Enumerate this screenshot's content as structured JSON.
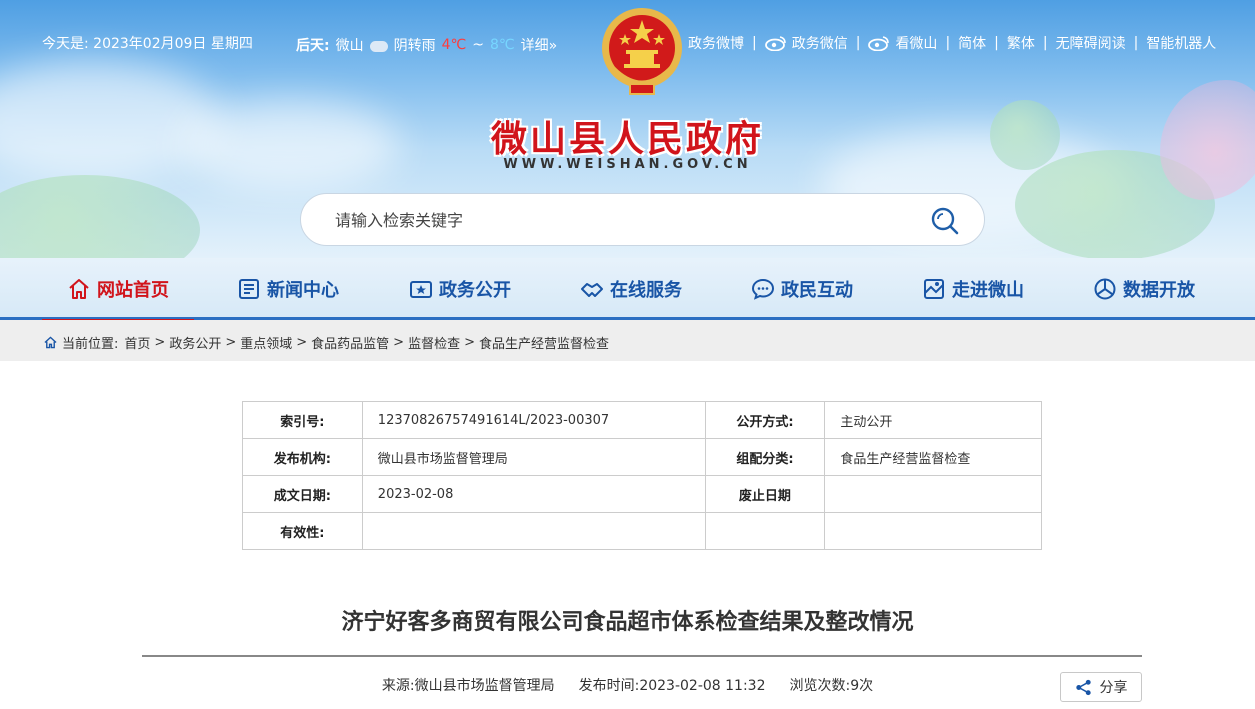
{
  "topbar": {
    "today": "今天是: 2023年02月09日 星期四",
    "weather_label": "后天:",
    "weather_city": "微山",
    "weather_desc": "阴转雨",
    "temp_high": "4℃",
    "temp_sep": "~",
    "temp_low": "8℃",
    "weather_more": "详细»",
    "links": [
      {
        "label": "政务微博",
        "icon": "weibo-icon"
      },
      {
        "label": "政务微信",
        "icon": "weibo-icon"
      },
      {
        "label": "看微山",
        "icon": "weibo-icon"
      },
      {
        "label": "简体"
      },
      {
        "label": "繁体"
      },
      {
        "label": "无障碍阅读"
      },
      {
        "label": "智能机器人"
      }
    ]
  },
  "site": {
    "title": "微山县人民政府",
    "url": "WWW.WEISHAN.GOV.CN"
  },
  "search": {
    "placeholder": "请输入检索关键字"
  },
  "nav": {
    "items": [
      {
        "label": "网站首页",
        "icon": "home-icon",
        "active": true
      },
      {
        "label": "新闻中心",
        "icon": "news-icon"
      },
      {
        "label": "政务公开",
        "icon": "gov-open-icon"
      },
      {
        "label": "在线服务",
        "icon": "handshake-icon"
      },
      {
        "label": "政民互动",
        "icon": "chat-icon"
      },
      {
        "label": "走进微山",
        "icon": "map-icon"
      },
      {
        "label": "数据开放",
        "icon": "data-icon"
      }
    ]
  },
  "breadcrumb": {
    "prefix": "当前位置:",
    "items": [
      "首页",
      "政务公开",
      "重点领域",
      "食品药品监管",
      "监督检查",
      "食品生产经营监督检查"
    ]
  },
  "meta": {
    "rows": [
      {
        "k1": "索引号:",
        "v1": "12370826757491614L/2023-00307",
        "k2": "公开方式:",
        "v2": "主动公开"
      },
      {
        "k1": "发布机构:",
        "v1": "微山县市场监督管理局",
        "k2": "组配分类:",
        "v2": "食品生产经营监督检查"
      },
      {
        "k1": "成文日期:",
        "v1": "2023-02-08",
        "k2": "废止日期",
        "v2": ""
      },
      {
        "k1": "有效性:",
        "v1": "",
        "k2": "",
        "v2": ""
      }
    ]
  },
  "article": {
    "title": "济宁好客多商贸有限公司食品超市体系检查结果及整改情况",
    "source": "来源:微山县市场监督管理局",
    "publish_time": "发布时间:2023-02-08 11:32",
    "views": "浏览次数:9次",
    "share_label": "分享"
  },
  "colors": {
    "brand_red": "#d1141b",
    "nav_blue": "#1955a6"
  }
}
